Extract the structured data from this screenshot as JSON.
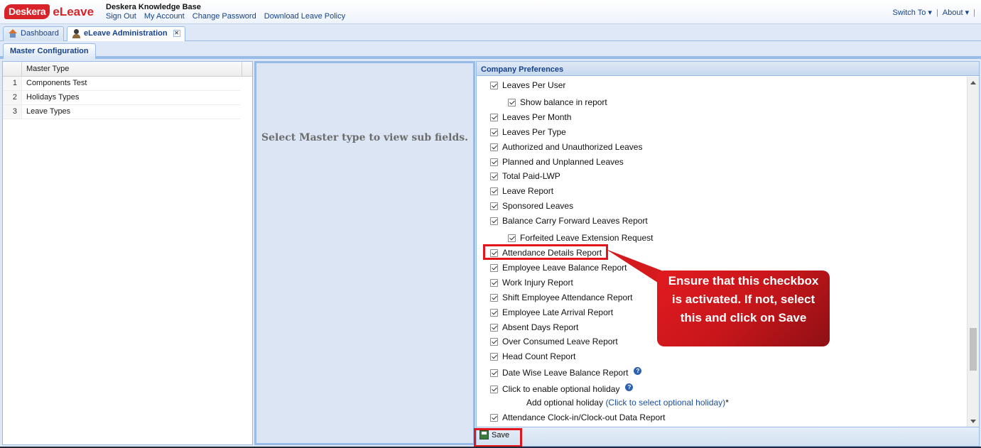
{
  "header": {
    "logo_badge": "Deskera",
    "logo_text": "eLeave",
    "title": "Deskera Knowledge Base",
    "links": [
      "Sign Out",
      "My Account",
      "Change Password",
      "Download Leave Policy"
    ],
    "switch_to": "Switch To",
    "about": "About",
    "separator": "|"
  },
  "tabs": [
    {
      "label": "Dashboard"
    },
    {
      "label": "eLeave Administration"
    }
  ],
  "subtab": {
    "label": "Master Configuration"
  },
  "master_grid": {
    "header": "Master Type",
    "rows": [
      {
        "num": "1",
        "label": "Components Test"
      },
      {
        "num": "2",
        "label": "Holidays Types"
      },
      {
        "num": "3",
        "label": "Leave Types"
      }
    ]
  },
  "middle": {
    "message": "Select Master type to view sub fields."
  },
  "preferences": {
    "title": "Company Preferences",
    "items": [
      {
        "label": "Leaves Per User"
      },
      {
        "label": "Show balance in report"
      },
      {
        "label": "Leaves Per Month"
      },
      {
        "label": "Leaves Per Type"
      },
      {
        "label": "Authorized and Unauthorized Leaves"
      },
      {
        "label": "Planned and Unplanned Leaves"
      },
      {
        "label": "Total Paid-LWP"
      },
      {
        "label": "Leave Report"
      },
      {
        "label": "Sponsored Leaves"
      },
      {
        "label": "Balance Carry Forward Leaves Report"
      },
      {
        "label": "Forfeited Leave Extension Request"
      },
      {
        "label": "Attendance Details Report"
      },
      {
        "label": "Employee Leave Balance Report"
      },
      {
        "label": "Work Injury Report"
      },
      {
        "label": "Shift Employee Attendance Report"
      },
      {
        "label": "Employee Late Arrival Report"
      },
      {
        "label": "Absent Days Report"
      },
      {
        "label": "Over Consumed Leave Report"
      },
      {
        "label": "Head Count Report"
      },
      {
        "label": "Date Wise Leave Balance Report"
      },
      {
        "label": "Click to enable optional holiday"
      },
      {
        "label": "Attendance Clock-in/Clock-out Data Report"
      }
    ],
    "optional_holiday_label": "Add optional holiday",
    "optional_holiday_link": "(Click to select optional holiday)",
    "optional_holiday_marker": "*",
    "help_glyph": "?"
  },
  "footer": {
    "save_label": "Save"
  },
  "callout": {
    "text": "Ensure that this checkbox is activated. If not, select this and click on Save"
  },
  "colors": {
    "accent": "#15428b",
    "panel_border": "#99bbe8",
    "highlight": "#e0161c",
    "callout": "#c8161b"
  }
}
